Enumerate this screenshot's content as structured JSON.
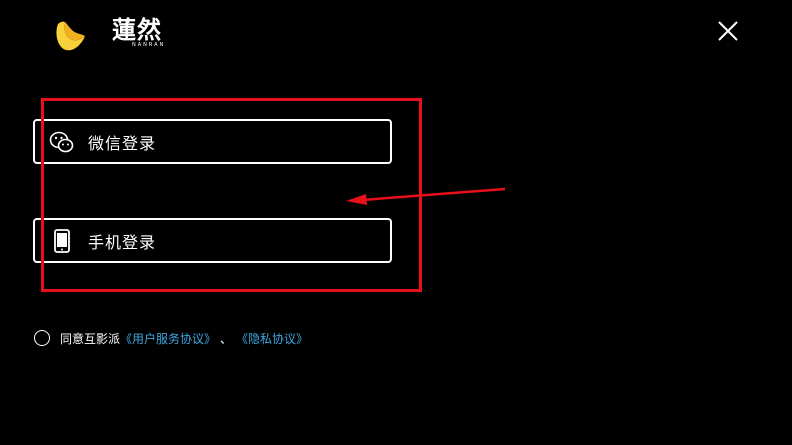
{
  "brand": {
    "name_text": "蓮然",
    "sub_text": "NANRAN",
    "icon": "banana-logo-icon"
  },
  "window": {
    "close_icon": "close-icon"
  },
  "login_options": [
    {
      "label": "微信登录",
      "icon": "wechat-icon"
    },
    {
      "label": "手机登录",
      "icon": "phone-icon"
    }
  ],
  "agreement": {
    "prefix": "同意互影派",
    "user_agreement_link": "《用户服务协议》",
    "separator": "、",
    "privacy_link": "《隐私协议》"
  },
  "colors": {
    "background": "#000000",
    "highlight": "#e8101a",
    "link": "#3fa7e0",
    "logo_yellow": "#f7d23a"
  }
}
